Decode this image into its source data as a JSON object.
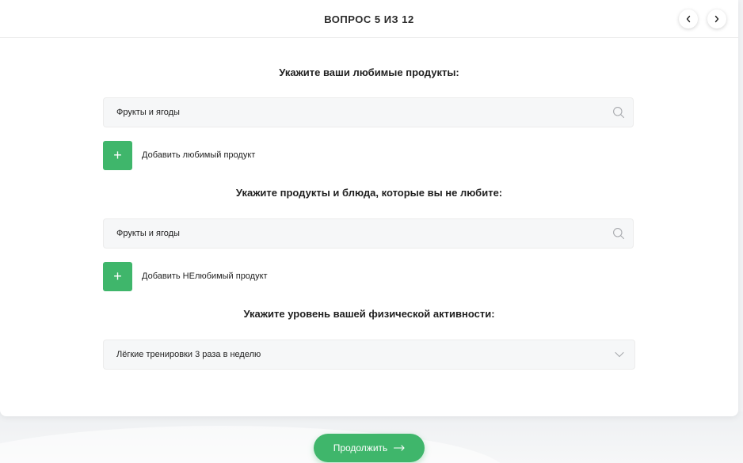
{
  "header": {
    "progress": "ВОПРОС 5 ИЗ 12",
    "prev_icon": "chevron-left-icon",
    "next_icon": "chevron-right-icon"
  },
  "favorites": {
    "title": "Укажите ваши любимые продукты:",
    "input_value": "Фрукты и ягоды",
    "search_icon": "search-icon",
    "add_icon": "plus-icon",
    "add_label": "Добавить любимый продукт"
  },
  "dislikes": {
    "title": "Укажите продукты и блюда, которые вы не любите:",
    "input_value": "Фрукты и ягоды",
    "search_icon": "search-icon",
    "add_icon": "plus-icon",
    "add_label": "Добавить НЕлюбимый продукт"
  },
  "activity": {
    "title": "Укажите уровень вашей физической активности:",
    "selected": "Лёгкие тренировки 3 раза в неделю",
    "chevron_icon": "chevron-down-icon"
  },
  "footer": {
    "continue_label": "Продолжить",
    "continue_icon": "arrow-right-icon"
  },
  "colors": {
    "accent": "#3fb66b",
    "field_bg": "#f6f7f8",
    "page_bg": "#f1f2f4"
  }
}
